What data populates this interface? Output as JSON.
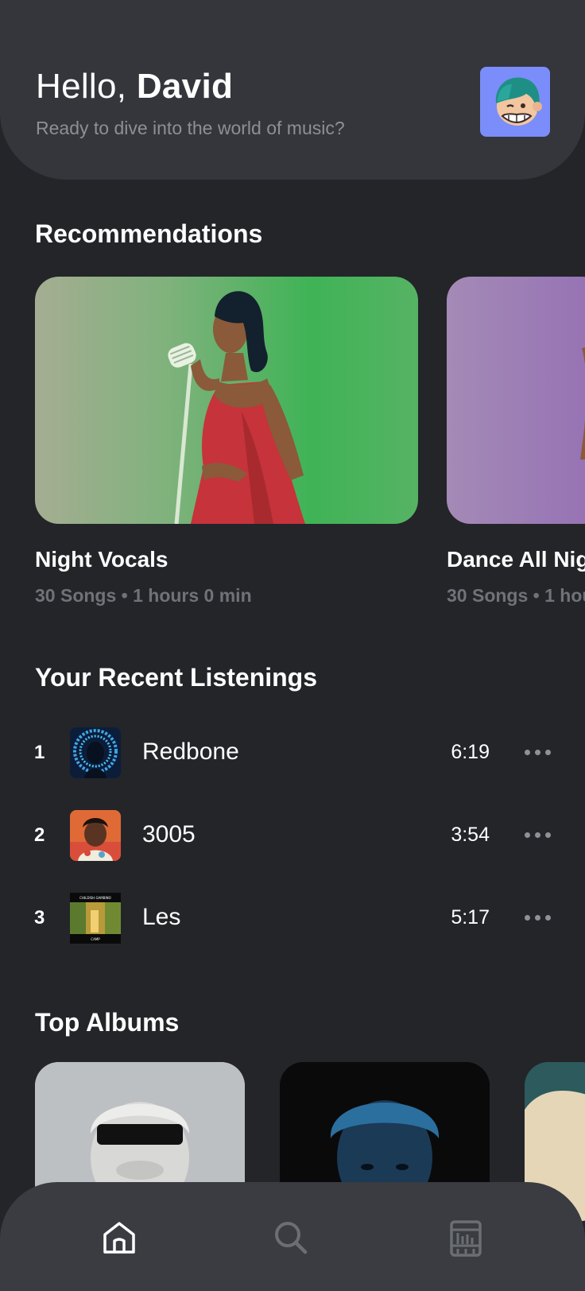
{
  "header": {
    "greeting_prefix": "Hello, ",
    "user_name": "David",
    "subtitle": "Ready to dive into the world of music?"
  },
  "recommendations": {
    "title": "Recommendations",
    "items": [
      {
        "title": "Night Vocals",
        "meta": "30 Songs • 1 hours 0 min"
      },
      {
        "title": "Dance All Nig",
        "meta": "30 Songs • 1 hou"
      }
    ]
  },
  "recent": {
    "title": "Your Recent Listenings",
    "tracks": [
      {
        "number": "1",
        "name": "Redbone",
        "duration": "6:19"
      },
      {
        "number": "2",
        "name": "3005",
        "duration": "3:54"
      },
      {
        "number": "3",
        "name": "Les",
        "duration": "5:17"
      }
    ],
    "cover3_band_top": "CHILDISH GAMBINO",
    "cover3_band_bottom": "CAMP"
  },
  "top_albums": {
    "title": "Top Albums"
  },
  "nav": {
    "items": [
      {
        "icon": "home-icon",
        "active": true
      },
      {
        "icon": "search-icon",
        "active": false
      },
      {
        "icon": "library-icon",
        "active": false
      }
    ]
  },
  "colors": {
    "background": "#232529",
    "header": "#34363b",
    "bottom_nav": "#3a3c41",
    "muted_text": "#8c8f96",
    "active_nav": "#ffffff",
    "inactive_nav": "#6b6e74"
  }
}
